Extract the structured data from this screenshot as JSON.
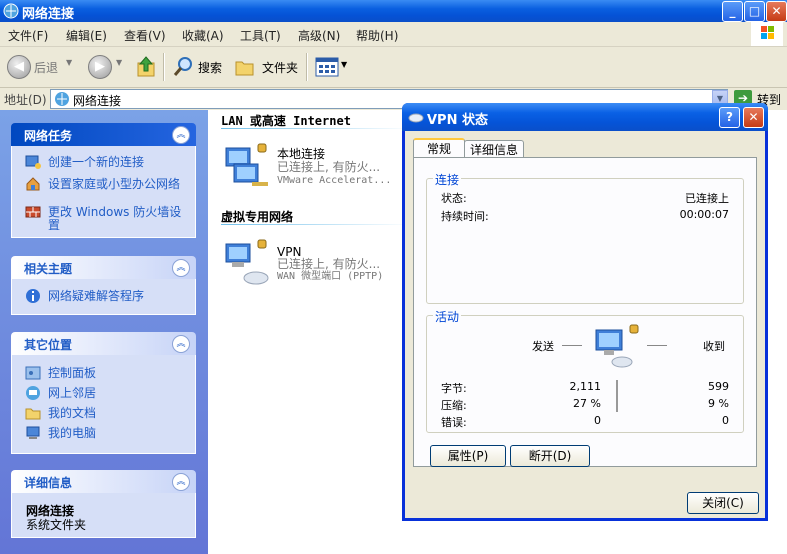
{
  "window": {
    "title": "网络连接"
  },
  "menu": [
    "文件(F)",
    "编辑(E)",
    "查看(V)",
    "收藏(A)",
    "工具(T)",
    "高级(N)",
    "帮助(H)"
  ],
  "toolbar": {
    "back": "后退",
    "search": "搜索",
    "folders": "文件夹"
  },
  "address": {
    "label": "地址(D)",
    "value": "网络连接",
    "go": "转到"
  },
  "sidebar": {
    "network_tasks": {
      "title": "网络任务",
      "items": [
        "创建一个新的连接",
        "设置家庭或小型办公网络",
        "更改 Windows 防火墙设置"
      ]
    },
    "related": {
      "title": "相关主题",
      "items": [
        "网络疑难解答程序"
      ]
    },
    "other_places": {
      "title": "其它位置",
      "items": [
        "控制面板",
        "网上邻居",
        "我的文档",
        "我的电脑"
      ]
    },
    "details": {
      "title": "详细信息",
      "name": "网络连接",
      "type": "系统文件夹"
    }
  },
  "content": {
    "lan_group": "LAN 或高速 Internet",
    "lan": {
      "name": "本地连接",
      "status": "已连接上, 有防火...",
      "device": "VMware Accelerat..."
    },
    "vpn_group": "虚拟专用网络",
    "vpn": {
      "name": "VPN",
      "status": "已连接上, 有防火...",
      "device": "WAN 微型端口 (PPTP)"
    }
  },
  "dialog": {
    "title": "VPN 状态",
    "help": "?",
    "close_glyph": "✕",
    "tabs": [
      "常规",
      "详细信息"
    ],
    "connection": {
      "legend": "连接",
      "status_label": "状态:",
      "status_value": "已连接上",
      "duration_label": "持续时间:",
      "duration_value": "00:00:07"
    },
    "activity": {
      "legend": "活动",
      "sent": "发送",
      "received": "收到",
      "rows": [
        {
          "label": "字节:",
          "sent": "2,111",
          "received": "599"
        },
        {
          "label": "压缩:",
          "sent": "27 %",
          "received": "9 %"
        },
        {
          "label": "错误:",
          "sent": "0",
          "received": "0"
        }
      ]
    },
    "buttons": {
      "properties": "属性(P)",
      "disconnect": "断开(D)",
      "close": "关闭(C)"
    }
  }
}
